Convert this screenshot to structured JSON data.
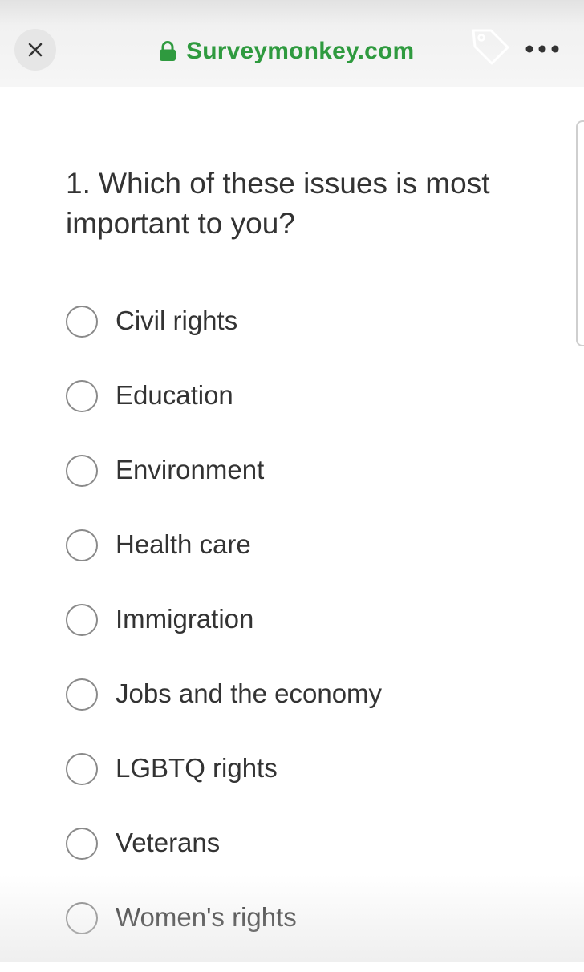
{
  "browser": {
    "url": "Surveymonkey.com",
    "url_color": "#2f9a3f",
    "icons": {
      "close": "close-icon",
      "lock": "lock-icon",
      "tag": "tag-icon",
      "more": "more-icon"
    }
  },
  "survey": {
    "question": "1. Which of these issues is most important to you?",
    "options": [
      "Civil rights",
      "Education",
      "Environment",
      "Health care",
      "Immigration",
      "Jobs and the economy",
      "LGBTQ rights",
      "Veterans",
      "Women's rights"
    ]
  }
}
